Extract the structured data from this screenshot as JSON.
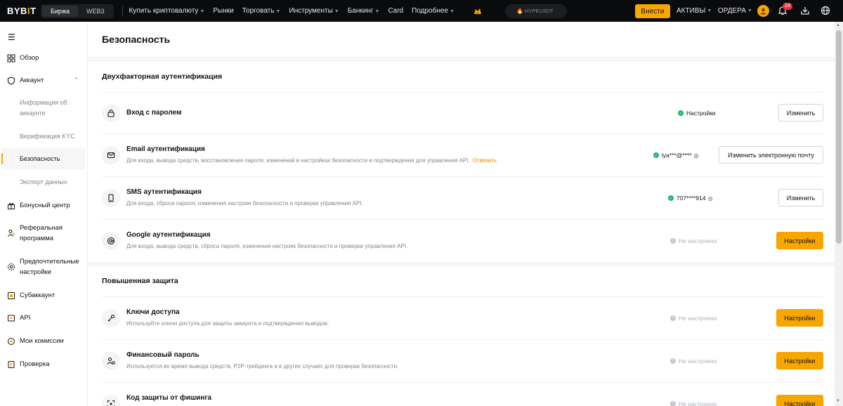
{
  "topbar": {
    "logo_a": "BYB",
    "logo_b": "I",
    "logo_c": "T",
    "seg_exchange": "Биржа",
    "seg_web3": "WEB3",
    "nav": [
      {
        "label": "Купить криптовалюту",
        "caret": true
      },
      {
        "label": "Рынки",
        "caret": false
      },
      {
        "label": "Торговать",
        "caret": true
      },
      {
        "label": "Инструменты",
        "caret": true
      },
      {
        "label": "Банкинг",
        "caret": true
      },
      {
        "label": "Card",
        "caret": false
      },
      {
        "label": "Подробнее",
        "caret": true
      }
    ],
    "search_placeholder": "HYPEUSDT",
    "deposit": "Внести",
    "assets": "АКТИВЫ",
    "orders": "ОРДЕРА",
    "notif_count": "24"
  },
  "sidebar": {
    "overview": "Обзор",
    "account": "Аккаунт",
    "account_info": "Информация об аккаунте",
    "kyc": "Верификация KYC",
    "security": "Безопасность",
    "export": "Экспорт данных",
    "bonus": "Бонусный центр",
    "referral": "Реферальная программа",
    "preferences": "Предпочтительные настройки",
    "subaccount": "Субаккаунт",
    "api": "API",
    "fees": "Мои комиссии",
    "audit": "Проверка"
  },
  "main": {
    "page_title": "Безопасность",
    "twofa_title": "Двухфакторная аутентификация",
    "password": {
      "title": "Вход с паролем",
      "status": "Настройки",
      "button": "Изменить"
    },
    "email": {
      "title": "Email аутентификация",
      "desc": "Для входа, вывода средств, восстановления пароля, изменений в настройках безопасности и подтверждения для управления API.",
      "unlink": "Отвязать",
      "status": "lya***@****",
      "button": "Изменить электронную почту"
    },
    "sms": {
      "title": "SMS аутентификация",
      "desc": "Для входа, сброса пароля, изменения настроек безопасности и проверки управления API.",
      "status": "707****914",
      "button": "Изменить"
    },
    "google": {
      "title": "Google аутентификация",
      "desc": "Для входа, вывода средств, сброса пароля, изменения настроек безопасности и проверки управления API.",
      "status": "Не настроено",
      "button": "Настройки"
    },
    "advanced_title": "Повышенная защита",
    "passkeys": {
      "title": "Ключи доступа",
      "desc": "Используйте ключи доступа для защиты аккаунта и подтверждения выводов.",
      "status": "Не настроено",
      "button": "Настройки"
    },
    "fund_password": {
      "title": "Финансовый пароль",
      "desc": "Используется во время вывода средств, P2P-трейдинга и в других случаях для проверки безопасности.",
      "status": "Не настроено",
      "button": "Настройки"
    },
    "antiphishing": {
      "title": "Код защиты от фишинга",
      "status": "Не настроено",
      "button": "Настройки"
    }
  },
  "colors": {
    "accent": "#f7a600",
    "ok": "#20b26c",
    "topbar": "#0a0b0d"
  }
}
